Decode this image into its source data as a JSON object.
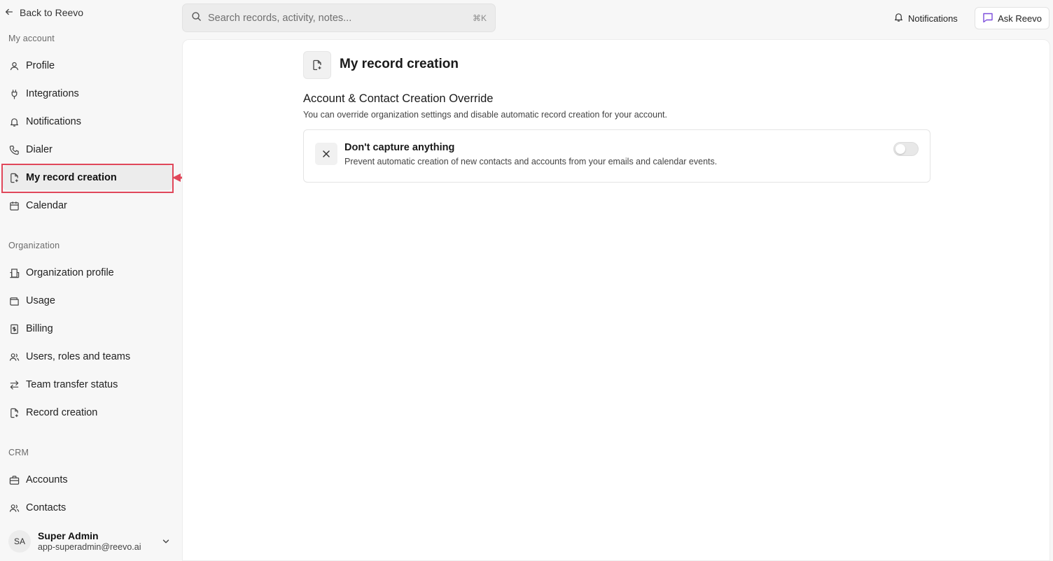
{
  "sidebar": {
    "back_label": "Back to Reevo",
    "sections": {
      "my_account": "My account",
      "organization": "Organization",
      "crm": "CRM"
    },
    "items": {
      "profile": "Profile",
      "integrations": "Integrations",
      "notifications": "Notifications",
      "dialer": "Dialer",
      "my_record_creation": "My record creation",
      "calendar": "Calendar",
      "organization_profile": "Organization profile",
      "usage": "Usage",
      "billing": "Billing",
      "users_roles_teams": "Users, roles and teams",
      "team_transfer_status": "Team transfer status",
      "record_creation": "Record creation",
      "accounts": "Accounts",
      "contacts": "Contacts"
    },
    "active_item": "my_record_creation",
    "user": {
      "initials": "SA",
      "name": "Super Admin",
      "email": "app-superadmin@reevo.ai"
    }
  },
  "topbar": {
    "search_placeholder": "Search records, activity, notes...",
    "search_shortcut": "⌘K",
    "notifications_label": "Notifications",
    "ask_label": "Ask Reevo"
  },
  "main": {
    "page_title": "My record creation",
    "section_heading": "Account & Contact Creation Override",
    "section_description": "You can override organization settings and disable automatic record creation for your account.",
    "setting": {
      "title": "Don't capture anything",
      "description": "Prevent automatic creation of new contacts and accounts from your emails and calendar events.",
      "enabled": false
    }
  },
  "colors": {
    "highlight": "#e0475a",
    "ask_icon": "#7c4ddb"
  }
}
